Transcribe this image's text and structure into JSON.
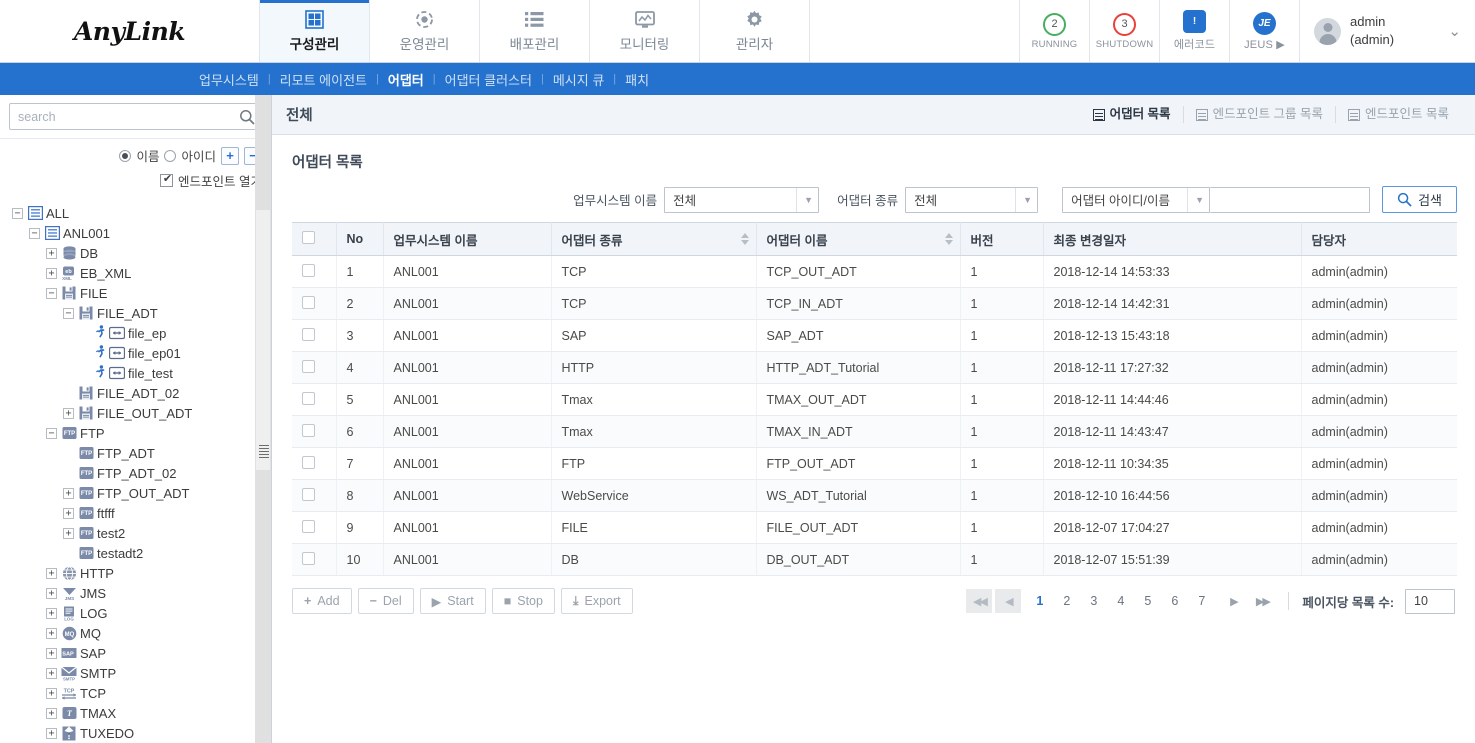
{
  "brand": {
    "logo": "AnyLink"
  },
  "main_tabs": [
    {
      "label": "구성관리",
      "icon": "grid-icon",
      "active": true
    },
    {
      "label": "운영관리",
      "icon": "target-icon",
      "active": false
    },
    {
      "label": "배포관리",
      "icon": "list-icon",
      "active": false
    },
    {
      "label": "모니터링",
      "icon": "monitor-icon",
      "active": false
    },
    {
      "label": "관리자",
      "icon": "gear-icon",
      "active": false
    }
  ],
  "status": {
    "running": {
      "count": "2",
      "label": "RUNNING",
      "color": "#48ad5e"
    },
    "shutdown": {
      "count": "3",
      "label": "SHUTDOWN",
      "color": "#e8413a"
    },
    "errorcode": {
      "label": "에러코드",
      "icon": "book-icon"
    },
    "jeus": {
      "label": "JEUS ▶",
      "badge": "JE"
    },
    "user": {
      "name": "admin",
      "id": "(admin)"
    }
  },
  "subnav": {
    "items": [
      {
        "label": "업무시스템",
        "active": false
      },
      {
        "label": "리모트 에이전트",
        "active": false
      },
      {
        "label": "어댑터",
        "active": true
      },
      {
        "label": "어댑터 클러스터",
        "active": false
      },
      {
        "label": "메시지 큐",
        "active": false
      },
      {
        "label": "패치",
        "active": false
      }
    ]
  },
  "sidebar": {
    "search": {
      "placeholder": "search",
      "value": ""
    },
    "radio_name": "이름",
    "radio_id": "아이디",
    "expand_label": "+",
    "collapse_label": "−",
    "endpoint_checkbox": "엔드포인트 열기",
    "tree": [
      {
        "label": "ALL",
        "depth": 0,
        "toggle": "−",
        "icon": "list-blue-icon"
      },
      {
        "label": "ANL001",
        "depth": 1,
        "toggle": "−",
        "icon": "list-blue-icon"
      },
      {
        "label": "DB",
        "depth": 2,
        "toggle": "+",
        "icon": "db-icon"
      },
      {
        "label": "EB_XML",
        "depth": 2,
        "toggle": "+",
        "icon": "ebxml-icon"
      },
      {
        "label": "FILE",
        "depth": 2,
        "toggle": "−",
        "icon": "file-icon"
      },
      {
        "label": "FILE_ADT",
        "depth": 3,
        "toggle": "−",
        "icon": "file-icon"
      },
      {
        "label": "file_ep",
        "depth": 4,
        "toggle": "",
        "icon": "endpoint-icon",
        "runner": true
      },
      {
        "label": "file_ep01",
        "depth": 4,
        "toggle": "",
        "icon": "endpoint-icon",
        "runner": true
      },
      {
        "label": "file_test",
        "depth": 4,
        "toggle": "",
        "icon": "endpoint-icon",
        "runner": true
      },
      {
        "label": "FILE_ADT_02",
        "depth": 3,
        "toggle": "",
        "icon": "file-icon"
      },
      {
        "label": "FILE_OUT_ADT",
        "depth": 3,
        "toggle": "+",
        "icon": "file-icon"
      },
      {
        "label": "FTP",
        "depth": 2,
        "toggle": "−",
        "icon": "ftp-icon"
      },
      {
        "label": "FTP_ADT",
        "depth": 3,
        "toggle": "",
        "icon": "ftp-icon"
      },
      {
        "label": "FTP_ADT_02",
        "depth": 3,
        "toggle": "",
        "icon": "ftp-icon"
      },
      {
        "label": "FTP_OUT_ADT",
        "depth": 3,
        "toggle": "+",
        "icon": "ftp-icon"
      },
      {
        "label": "ftfff",
        "depth": 3,
        "toggle": "+",
        "icon": "ftp-icon"
      },
      {
        "label": "test2",
        "depth": 3,
        "toggle": "+",
        "icon": "ftp-icon"
      },
      {
        "label": "testadt2",
        "depth": 3,
        "toggle": "",
        "icon": "ftp-icon"
      },
      {
        "label": "HTTP",
        "depth": 2,
        "toggle": "+",
        "icon": "globe-icon"
      },
      {
        "label": "JMS",
        "depth": 2,
        "toggle": "+",
        "icon": "jms-icon"
      },
      {
        "label": "LOG",
        "depth": 2,
        "toggle": "+",
        "icon": "log-icon"
      },
      {
        "label": "MQ",
        "depth": 2,
        "toggle": "+",
        "icon": "mq-icon"
      },
      {
        "label": "SAP",
        "depth": 2,
        "toggle": "+",
        "icon": "sap-icon"
      },
      {
        "label": "SMTP",
        "depth": 2,
        "toggle": "+",
        "icon": "smtp-icon"
      },
      {
        "label": "TCP",
        "depth": 2,
        "toggle": "+",
        "icon": "tcp-icon"
      },
      {
        "label": "TMAX",
        "depth": 2,
        "toggle": "+",
        "icon": "tmax-icon"
      },
      {
        "label": "TUXEDO",
        "depth": 2,
        "toggle": "+",
        "icon": "tuxedo-icon"
      }
    ]
  },
  "main": {
    "header_title": "전체",
    "view_tabs": [
      {
        "label": "어댑터 목록",
        "active": true
      },
      {
        "label": "엔드포인트 그룹 목록",
        "active": false
      },
      {
        "label": "엔드포인트 목록",
        "active": false
      }
    ],
    "section_title": "어댑터 목록",
    "filters": {
      "system_label": "업무시스템 이름",
      "system_value": "전체",
      "type_label": "어댑터 종류",
      "type_value": "전체",
      "keyword_label": "어댑터 아이디/이름",
      "keyword_value": "",
      "search_button": "검색"
    },
    "table": {
      "columns": [
        "No",
        "업무시스템 이름",
        "어댑터 종류",
        "어댑터 이름",
        "버전",
        "최종 변경일자",
        "담당자"
      ],
      "rows": [
        {
          "no": "1",
          "system": "ANL001",
          "type": "TCP",
          "name": "TCP_OUT_ADT",
          "ver": "1",
          "modified": "2018-12-14 14:53:33",
          "owner": "admin(admin)"
        },
        {
          "no": "2",
          "system": "ANL001",
          "type": "TCP",
          "name": "TCP_IN_ADT",
          "ver": "1",
          "modified": "2018-12-14 14:42:31",
          "owner": "admin(admin)"
        },
        {
          "no": "3",
          "system": "ANL001",
          "type": "SAP",
          "name": "SAP_ADT",
          "ver": "1",
          "modified": "2018-12-13 15:43:18",
          "owner": "admin(admin)"
        },
        {
          "no": "4",
          "system": "ANL001",
          "type": "HTTP",
          "name": "HTTP_ADT_Tutorial",
          "ver": "1",
          "modified": "2018-12-11 17:27:32",
          "owner": "admin(admin)"
        },
        {
          "no": "5",
          "system": "ANL001",
          "type": "Tmax",
          "name": "TMAX_OUT_ADT",
          "ver": "1",
          "modified": "2018-12-11 14:44:46",
          "owner": "admin(admin)"
        },
        {
          "no": "6",
          "system": "ANL001",
          "type": "Tmax",
          "name": "TMAX_IN_ADT",
          "ver": "1",
          "modified": "2018-12-11 14:43:47",
          "owner": "admin(admin)"
        },
        {
          "no": "7",
          "system": "ANL001",
          "type": "FTP",
          "name": "FTP_OUT_ADT",
          "ver": "1",
          "modified": "2018-12-11 10:34:35",
          "owner": "admin(admin)"
        },
        {
          "no": "8",
          "system": "ANL001",
          "type": "WebService",
          "name": "WS_ADT_Tutorial",
          "ver": "1",
          "modified": "2018-12-10 16:44:56",
          "owner": "admin(admin)"
        },
        {
          "no": "9",
          "system": "ANL001",
          "type": "FILE",
          "name": "FILE_OUT_ADT",
          "ver": "1",
          "modified": "2018-12-07 17:04:27",
          "owner": "admin(admin)"
        },
        {
          "no": "10",
          "system": "ANL001",
          "type": "DB",
          "name": "DB_OUT_ADT",
          "ver": "1",
          "modified": "2018-12-07 15:51:39",
          "owner": "admin(admin)"
        }
      ]
    },
    "actions": [
      {
        "label": "Add",
        "glyph": "+"
      },
      {
        "label": "Del",
        "glyph": "−"
      },
      {
        "label": "Start",
        "glyph": "▶"
      },
      {
        "label": "Stop",
        "glyph": "■"
      },
      {
        "label": "Export",
        "glyph": "⤓"
      }
    ],
    "pager": {
      "first": "◀◀",
      "prev": "◀",
      "next": "▶",
      "last": "▶▶",
      "pages": [
        "1",
        "2",
        "3",
        "4",
        "5",
        "6",
        "7"
      ],
      "current": "1",
      "per_page_label": "페이지당 목록 수:",
      "per_page_value": "10"
    }
  }
}
